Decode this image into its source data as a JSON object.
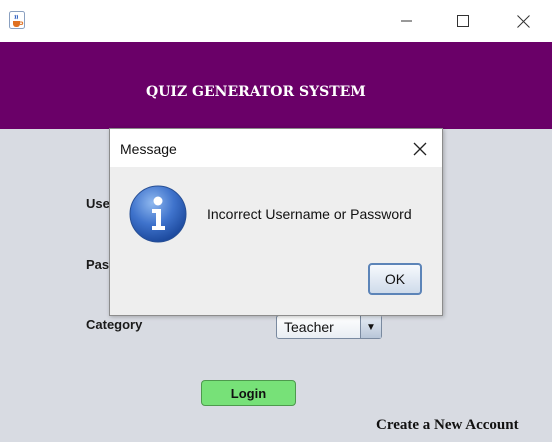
{
  "window": {
    "icon": "java-coffee-cup-icon"
  },
  "banner": {
    "title": "QUIZ GENERATOR SYSTEM",
    "color": "#6a0068"
  },
  "form": {
    "username_label": "Use",
    "password_label": "Pas",
    "category_label": "Category",
    "category_value": "Teacher",
    "login_label": "Login",
    "login_color": "#77e178",
    "create_account_label": "Create a New Account"
  },
  "dialog": {
    "title": "Message",
    "message": "Incorrect Username or Password",
    "ok_label": "OK",
    "icon": "info-icon"
  }
}
